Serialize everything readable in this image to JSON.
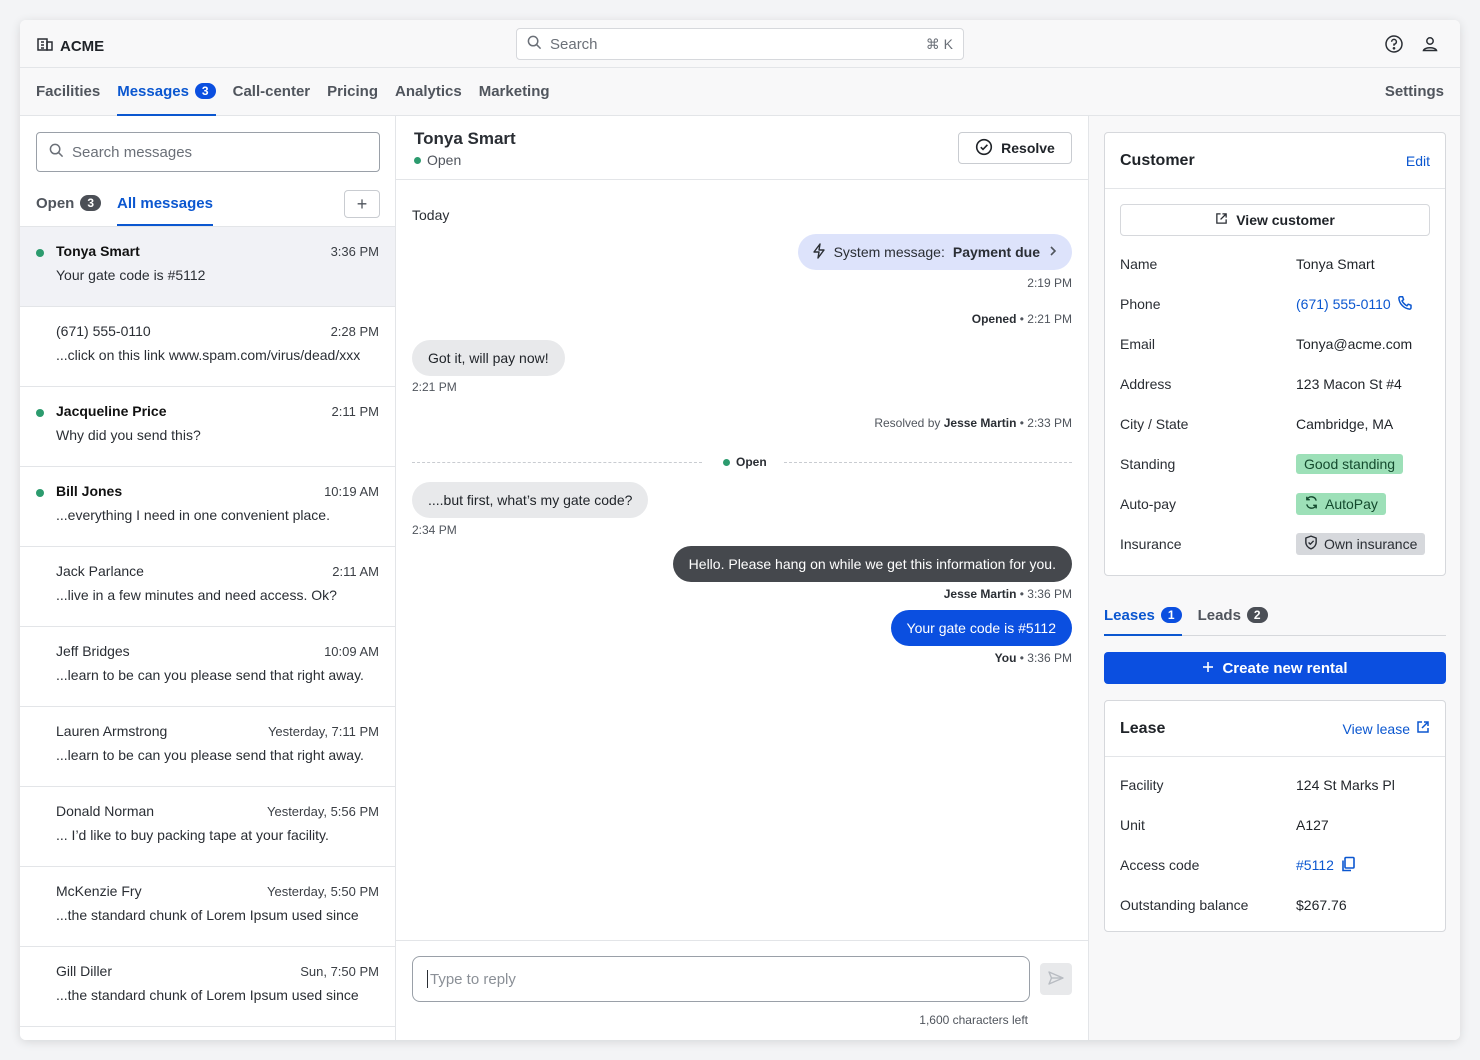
{
  "app": {
    "brand": "ACME"
  },
  "search": {
    "placeholder": "Search",
    "shortcut": "⌘ K"
  },
  "nav": {
    "tabs": [
      {
        "label": "Facilities"
      },
      {
        "label": "Messages",
        "badge": "3"
      },
      {
        "label": "Call-center"
      },
      {
        "label": "Pricing"
      },
      {
        "label": "Analytics"
      },
      {
        "label": "Marketing"
      }
    ],
    "settings": "Settings"
  },
  "inbox": {
    "search_placeholder": "Search messages",
    "tabs": {
      "open_label": "Open",
      "open_count": "3",
      "all_label": "All messages"
    },
    "add_icon": "+",
    "conversations": [
      {
        "name": "Tonya Smart",
        "time": "3:36 PM",
        "preview": "Your gate code is #5112"
      },
      {
        "name": "(671) 555-0110",
        "time": "2:28 PM",
        "preview": "...click on this link www.spam.com/virus/dead/xxx"
      },
      {
        "name": "Jacqueline Price",
        "time": "2:11 PM",
        "preview": "Why did you send this?"
      },
      {
        "name": "Bill Jones",
        "time": "10:19 AM",
        "preview": "...everything I need in one convenient place."
      },
      {
        "name": "Jack Parlance",
        "time": "2:11 AM",
        "preview": "...live in a few minutes and need access. Ok?"
      },
      {
        "name": "Jeff Bridges",
        "time": "10:09 AM",
        "preview": "...learn to be can you please send that right away."
      },
      {
        "name": "Lauren Armstrong",
        "time": "Yesterday, 7:11 PM",
        "preview": "...learn to be can you please send that right away."
      },
      {
        "name": "Donald Norman",
        "time": "Yesterday, 5:56 PM",
        "preview": "... I’d like to buy packing tape at your facility."
      },
      {
        "name": "McKenzie Fry",
        "time": "Yesterday, 5:50 PM",
        "preview": "...the standard chunk of Lorem Ipsum used since"
      },
      {
        "name": "Gill Diller",
        "time": "Sun, 7:50 PM",
        "preview": "...the standard chunk of Lorem Ipsum used since"
      }
    ]
  },
  "chat": {
    "name": "Tonya Smart",
    "status": "Open",
    "resolve_label": "Resolve",
    "day": "Today",
    "system_prefix": "System message:",
    "system_bold": "Payment due",
    "system_time": "2:19 PM",
    "opened_label": "Opened",
    "opened_time": "• 2:21 PM",
    "msg1": "Got it, will pay now!",
    "msg1_time": "2:21 PM",
    "resolved_prefix": "Resolved by",
    "resolved_by": "Jesse Martin",
    "resolved_time": "• 2:33 PM",
    "divider_label": "Open",
    "msg2": "....but first, what’s my gate code?",
    "msg2_time": "2:34 PM",
    "msg3": "Hello. Please hang on while we get this information for you.",
    "msg3_author": "Jesse Martin",
    "msg3_time": "• 3:36 PM",
    "msg4": "Your gate code is #5112",
    "msg4_author": "You",
    "msg4_time": "• 3:36 PM",
    "reply_placeholder": "Type to reply",
    "chars_left": "1,600 characters left"
  },
  "customer": {
    "title": "Customer",
    "edit": "Edit",
    "view_customer": "View customer",
    "fields": [
      {
        "label": "Name",
        "value": "Tonya Smart"
      },
      {
        "label": "Phone",
        "value": "(671) 555-0110"
      },
      {
        "label": "Email",
        "value": "Tonya@acme.com"
      },
      {
        "label": "Address",
        "value": "123 Macon St #4"
      },
      {
        "label": "City / State",
        "value": "Cambridge, MA"
      },
      {
        "label": "Standing",
        "value": "Good standing"
      },
      {
        "label": "Auto-pay",
        "value": "AutoPay"
      },
      {
        "label": "Insurance",
        "value": "Own insurance"
      }
    ]
  },
  "right_tabs": {
    "leases": "Leases",
    "leases_count": "1",
    "leads": "Leads",
    "leads_count": "2"
  },
  "create_rental": "Create new rental",
  "lease": {
    "title": "Lease",
    "view_lease": "View lease",
    "fields": [
      {
        "label": "Facility",
        "value": "124 St Marks Pl"
      },
      {
        "label": "Unit",
        "value": "A127"
      },
      {
        "label": "Access code",
        "value": "#5112"
      },
      {
        "label": "Outstanding balance",
        "value": "$267.76"
      }
    ]
  },
  "colors": {
    "accent": "#0b4fe0",
    "online": "#2c9b6e",
    "system_bubble": "#dde3fb"
  }
}
